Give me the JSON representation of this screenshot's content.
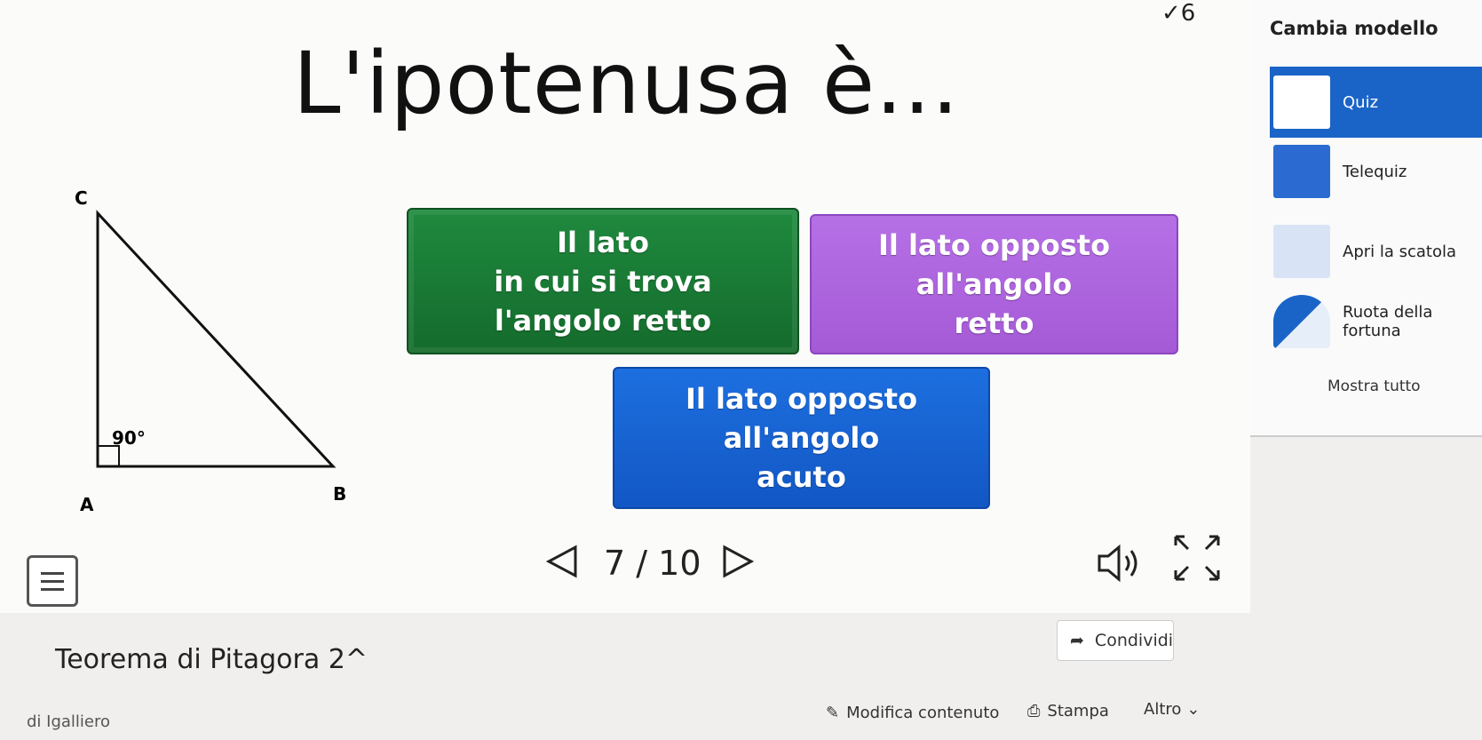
{
  "activity": {
    "question": "L'ipotenusa è...",
    "score": "✓6",
    "answers": {
      "a1": [
        "Il lato",
        "in cui si trova",
        "l'angolo retto"
      ],
      "a2": [
        "Il lato opposto",
        "all'angolo",
        "retto"
      ],
      "a3": [
        "Il lato opposto",
        "all'angolo",
        "acuto"
      ]
    },
    "triangle": {
      "top_label": "C",
      "left_label": "A",
      "right_label": "B",
      "angle": "90°"
    },
    "pager": "7 / 10"
  },
  "page": {
    "title": "Teorema di Pitagora 2^",
    "share_label": "Condividi",
    "author": "di  Igalliero",
    "edit_label": "Modifica contenuto",
    "print_label": "Stampa",
    "more_label": "Altro"
  },
  "sidebar": {
    "header": "Cambia modello",
    "templates": [
      {
        "label": "Quiz",
        "selected": true
      },
      {
        "label": "Telequiz"
      },
      {
        "label": "Apri la scatola"
      },
      {
        "label_line1": "Ruota della",
        "label_line2": "fortuna"
      }
    ],
    "show_all": "Mostra tutto"
  },
  "colors": {
    "green": "#1a7d37",
    "purple": "#ad63de",
    "blue": "#1866d6",
    "selected": "#1a64c7"
  }
}
